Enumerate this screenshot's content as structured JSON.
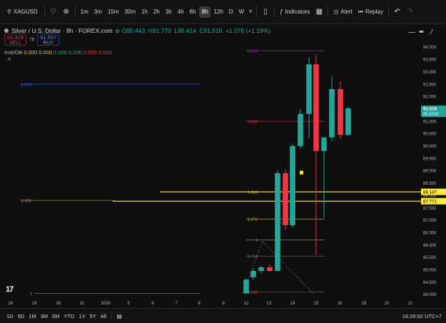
{
  "toolbar": {
    "symbol": "XAGUSD",
    "intervals": [
      "1m",
      "3m",
      "15m",
      "30m",
      "1h",
      "2h",
      "3h",
      "4h",
      "6h",
      "8h",
      "12h",
      "D",
      "W"
    ],
    "active_interval": "8h",
    "indicators_label": "Indicators",
    "alert_label": "Alert",
    "replay_label": "Replay"
  },
  "legend": {
    "title": "Silver / U.S. Dollar · 8h · FOREX.com",
    "open": "O90.443",
    "high": "H91.770",
    "low": "L90.414",
    "close": "C91.519",
    "change": "+1.076 (+1.19%)",
    "sell_price": "91.479",
    "sell_label": "SELL",
    "spread": "78",
    "buy_price": "91.557",
    "buy_label": "BUY",
    "indicator_name": "Imb/OB",
    "indicator_values": [
      "0.000",
      "0.000",
      "0.000",
      "0.000",
      "0.000",
      "0.000"
    ]
  },
  "chart_data": {
    "type": "candlestick",
    "price_axis_ticks": [
      "94.000",
      "93.500",
      "93.000",
      "92.500",
      "92.000",
      "91.500",
      "91.000",
      "90.500",
      "90.000",
      "89.500",
      "89.000",
      "88.500",
      "88.000",
      "87.500",
      "87.000",
      "86.500",
      "86.000",
      "85.500",
      "85.000",
      "84.500",
      "84.000"
    ],
    "time_axis_ticks": [
      "26",
      "29",
      "30",
      "31",
      "2026",
      "5",
      "6",
      "7",
      "8",
      "9",
      "12",
      "13",
      "14",
      "15",
      "16",
      "19",
      "20",
      "21"
    ],
    "current_price": "91.519",
    "countdown": "05:33:58",
    "price_labels": [
      {
        "value": 88.147,
        "text": "88.147",
        "style": "yellow"
      },
      {
        "value": 87.771,
        "text": "87.771",
        "style": "yellow"
      }
    ],
    "candles": [
      {
        "x": 345,
        "open": 84.05,
        "high": 84.65,
        "low": 84.0,
        "close": 84.6
      },
      {
        "x": 355,
        "open": 84.7,
        "high": 85.05,
        "low": 84.6,
        "close": 84.95
      },
      {
        "x": 366,
        "open": 84.95,
        "high": 85.15,
        "low": 84.85,
        "close": 85.1
      },
      {
        "x": 378,
        "open": 85.1,
        "high": 85.2,
        "low": 84.95,
        "close": 84.95
      },
      {
        "x": 389,
        "open": 84.95,
        "high": 89.0,
        "low": 84.95,
        "close": 88.9
      },
      {
        "x": 400,
        "open": 88.9,
        "high": 89.05,
        "low": 86.6,
        "close": 86.8
      },
      {
        "x": 410,
        "open": 86.8,
        "high": 90.1,
        "low": 86.7,
        "close": 90.0
      },
      {
        "x": 421,
        "open": 90.0,
        "high": 91.5,
        "low": 89.9,
        "close": 91.3
      },
      {
        "x": 433,
        "open": 91.3,
        "high": 93.6,
        "low": 90.3,
        "close": 93.3
      },
      {
        "x": 443,
        "open": 93.3,
        "high": 93.7,
        "low": 85.6,
        "close": 89.8
      },
      {
        "x": 454,
        "open": 89.8,
        "high": 90.3,
        "low": 87.1,
        "close": 90.35
      },
      {
        "x": 465,
        "open": 90.35,
        "high": 92.8,
        "low": 90.2,
        "close": 92.3
      },
      {
        "x": 477,
        "open": 92.3,
        "high": 92.6,
        "low": 90.3,
        "close": 90.45
      },
      {
        "x": 488,
        "open": 90.45,
        "high": 91.6,
        "low": 90.4,
        "close": 91.52
      }
    ],
    "fib_levels": [
      {
        "label": "1.618",
        "value": 92.5,
        "color": "#2962ff",
        "x1": 28,
        "x2": 280,
        "label_x": 30
      },
      {
        "label": "1.272",
        "value": 87.8,
        "color": "#e0a020",
        "x1": 28,
        "x2": 160,
        "label_x": 30
      },
      {
        "label": "3.618",
        "value": 93.85,
        "color": "#9c27b0",
        "x1": 345,
        "x2": 455,
        "label_x": 347
      },
      {
        "label": "2.618",
        "value": 91.0,
        "color": "#f23645",
        "x1": 345,
        "x2": 455,
        "label_x": 347
      },
      {
        "label": "1.618",
        "value": 88.15,
        "color": "#e0c23c",
        "x1": 345,
        "x2": 455,
        "label_x": 347
      },
      {
        "label": "1.272",
        "value": 87.05,
        "color": "#e0a020",
        "x1": 345,
        "x2": 455,
        "label_x": 347
      },
      {
        "label": "1",
        "value": 86.2,
        "color": "#9e9e9e",
        "x1": 345,
        "x2": 455,
        "label_x": 358
      },
      {
        "label": "0.764",
        "value": 85.55,
        "color": "#f23645",
        "x1": 345,
        "x2": 455,
        "label_x": 347
      },
      {
        "label": "0.236",
        "value": 84.1,
        "color": "#f23645",
        "x1": 345,
        "x2": 455,
        "label_x": 347
      }
    ],
    "bottom_axis_labels": [
      {
        "label": "1",
        "x": 42
      }
    ],
    "ylim": [
      83.9,
      94.4
    ]
  },
  "bottom": {
    "ranges": [
      "1D",
      "5D",
      "1M",
      "3M",
      "6M",
      "YTD",
      "1Y",
      "5Y",
      "All"
    ],
    "clock": "16:26:02 UTC+7"
  }
}
